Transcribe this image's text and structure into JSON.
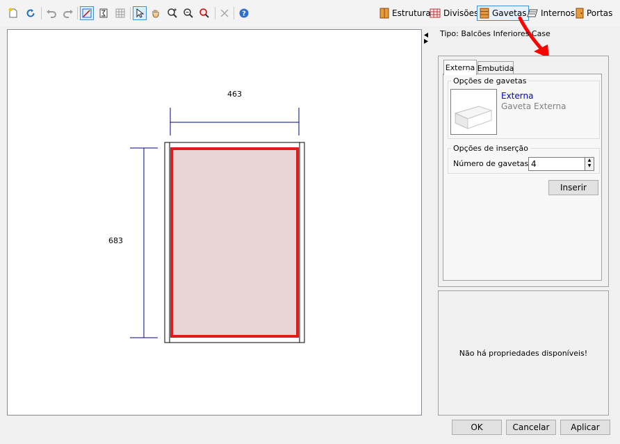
{
  "toolbar_right": {
    "estrutura": "Estrutura",
    "divisoes": "Divisões",
    "gavetas": "Gavetas",
    "internos": "Internos",
    "portas": "Portas"
  },
  "drawing": {
    "width_label": "463",
    "height_label": "683"
  },
  "panel": {
    "tipo_label": "Tipo: Balcões Inferiores Case",
    "tabs": [
      "Externa",
      "Embutida"
    ],
    "drawer_options_title": "Opções de gavetas",
    "drawer_option_name": "Externa",
    "drawer_option_desc": "Gaveta Externa",
    "insertion_title": "Opções de inserção",
    "drawer_count_label": "Número de gavetas:",
    "drawer_count_value": "4",
    "insert_button": "Inserir",
    "no_properties": "Não há propriedades disponíveis!"
  },
  "footer": {
    "ok": "OK",
    "cancel": "Cancelar",
    "apply": "Aplicar"
  },
  "colors": {
    "accent": "#3f8ed6",
    "dimension_line": "#00008b",
    "drawer_fill": "#e8d5d5",
    "drawer_border": "#e01b1b",
    "link_blue": "#0000c8",
    "annotation_arrow": "#ff0000"
  },
  "icons": {
    "toolbar": [
      "new-icon",
      "refresh-icon",
      "undo-icon",
      "redo-icon",
      "draw-mode-icon",
      "sum-icon",
      "grid-icon",
      "pointer-icon",
      "pan-hand-icon",
      "zoom-in-icon",
      "zoom-fit-icon",
      "zoom-window-icon",
      "delete-icon",
      "help-icon"
    ]
  }
}
